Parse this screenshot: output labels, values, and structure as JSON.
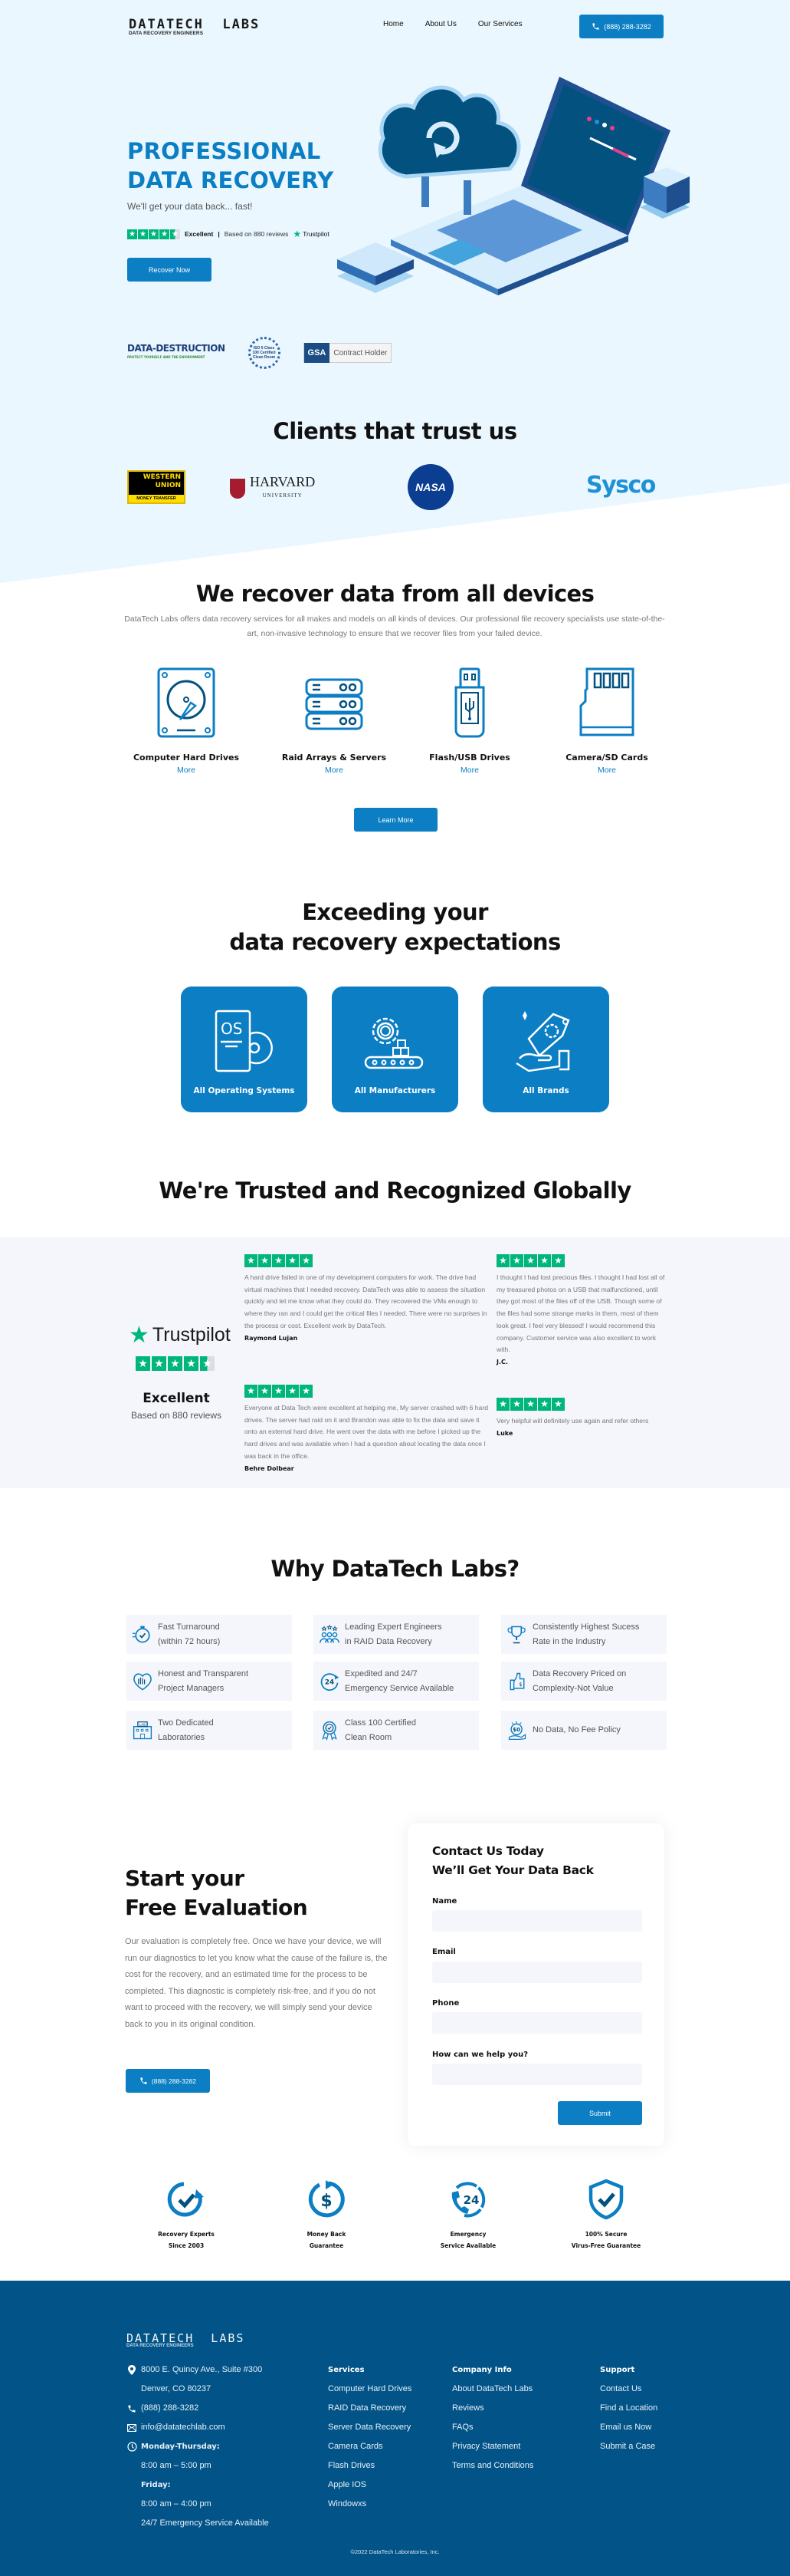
{
  "header": {
    "logo_main": "DATATECH  LABS",
    "logo_sub": "DATA RECOVERY ENGINEERS",
    "nav": [
      "Home",
      "About Us",
      "Our Services"
    ],
    "phone": "(888) 288-3282"
  },
  "hero": {
    "title_line1": "PROFESSIONAL",
    "title_line2": "DATA RECOVERY",
    "subtitle": "We'll get your data back... fast!",
    "rating_label": "Excellent",
    "rating_separator": "|",
    "rating_reviews": "Based on 880 reviews",
    "trustpilot": "Trustpilot",
    "rating_stars": 4.5,
    "cta": "Recover Now",
    "certs": {
      "data_destruction": "DATA-DESTRUCTION",
      "data_destruction_tag": "PROTECT YOURSELF AND THE ENVIRONMENT",
      "iso": "ISO 5 Class 100 Certified Clean Room",
      "gsa": "GSA",
      "gsa_text": "Contract Holder"
    }
  },
  "clients": {
    "title": "Clients that trust us",
    "logos": {
      "western_union_1": "WESTERN",
      "western_union_2": "UNION",
      "western_union_3": "MONEY TRANSFER",
      "harvard": "HARVARD",
      "harvard_sub": "UNIVERSITY",
      "nasa": "NASA",
      "sysco": "Sysco"
    }
  },
  "devices": {
    "title": "We recover data from all devices",
    "description": "DataTech Labs offers data recovery services for all makes and models on all kinds of devices. Our professional file recovery specialists use state-of-the-art, non-invasive technology to ensure that we recover files from your failed device.",
    "items": [
      {
        "name": "Computer Hard Drives",
        "link": "More",
        "icon": "hard-drive-icon"
      },
      {
        "name": "Raid Arrays & Servers",
        "link": "More",
        "icon": "server-icon"
      },
      {
        "name": "Flash/USB Drives",
        "link": "More",
        "icon": "usb-drive-icon"
      },
      {
        "name": "Camera/SD Cards",
        "link": "More",
        "icon": "sd-card-icon"
      }
    ],
    "cta": "Learn More"
  },
  "expectations": {
    "title_line1": "Exceeding your",
    "title_line2": "data recovery expectations",
    "cards": [
      {
        "label": "All Operating Systems",
        "icon": "os-disc-icon",
        "icon_text": "OS"
      },
      {
        "label": "All Manufacturers",
        "icon": "gear-conveyor-icon"
      },
      {
        "label": "All Brands",
        "icon": "brand-tag-hand-icon"
      }
    ]
  },
  "trusted": {
    "title": "We're Trusted and Recognized Globally",
    "trustpilot": "Trustpilot",
    "rating_stars": 4.5,
    "rating_label": "Excellent",
    "rating_reviews": "Based on 880 reviews",
    "reviews": [
      {
        "stars": 5,
        "text": "A hard drive failed in one of my development computers for work. The drive had virtual machines that I needed recovery. DataTech was able to assess the situation quickly and let me know what they could do. They recovered the VMs enough to where they ran and I could get the critical files I needed. There were no surprises in the process or cost. Excellent work by DataTech.",
        "author": "Raymond Lujan"
      },
      {
        "stars": 5,
        "text": "I thought I had lost precious files. I thought I had lost all of my treasured photos on a USB that malfunctioned, until they got most of the files off of the USB. Though some of the files had some strange marks in them, most of them look great. I feel very blessed! I would recommend this company. Customer service was also excellent to work with.",
        "author": "J.C."
      },
      {
        "stars": 5,
        "text": "Everyone at Data Tech were excellent at helping me, My server crashed with 6 hard drives. The server had raid on it and Brandon was able to fix the data and save it onto an external hard drive. He went over the data with me before I picked up the hard drives and was available when I had a question about locating the data once I was back in the office.",
        "author": "Behre Dolbear"
      },
      {
        "stars": 5,
        "text": "Very helpful will definitely use again and refer others",
        "author": "Luke"
      }
    ]
  },
  "why": {
    "title": "Why DataTech Labs?",
    "items": [
      {
        "line1": "Fast Turnaround",
        "line2": "(within 72 hours)",
        "icon": "stopwatch-icon"
      },
      {
        "line1": "Leading Expert Engineers",
        "line2": "in RAID Data Recovery",
        "icon": "expert-team-icon"
      },
      {
        "line1": "Consistently Highest Sucess",
        "line2": "Rate in the Industry",
        "icon": "trophy-icon"
      },
      {
        "line1": "Honest and Transparent",
        "line2": "Project Managers",
        "icon": "heart-hand-icon"
      },
      {
        "line1": "Expedited and 24/7",
        "line2": "Emergency Service Available",
        "icon": "clock-24-icon"
      },
      {
        "line1": "Data Recovery Priced on",
        "line2": "Complexity-Not Value",
        "icon": "price-tag-icon"
      },
      {
        "line1": "Two Dedicated",
        "line2": "Laboratories",
        "icon": "lab-building-icon"
      },
      {
        "line1": "Class 100 Certified",
        "line2": "Clean Room",
        "icon": "certified-badge-icon"
      },
      {
        "line1": "No Data, No Fee Policy",
        "line2": "",
        "icon": "zero-fee-icon"
      }
    ]
  },
  "evaluation": {
    "title_line1": "Start your",
    "title_line2": "Free Evaluation",
    "text": "Our evaluation is completely free. Once we have your device, we will run our diagnostics to let you know what the cause of the failure is, the cost for the recovery, and an estimated time for the process to be completed. This diagnostic is completely risk-free, and if you do not want to proceed with the recovery, we will simply send your device back to you in its original condition.",
    "phone": "(888) 288-3282"
  },
  "form": {
    "title_line1": "Contact Us Today",
    "title_line2": "We’ll Get Your Data Back",
    "fields": [
      {
        "label": "Name",
        "value": ""
      },
      {
        "label": "Email",
        "value": ""
      },
      {
        "label": "Phone",
        "value": ""
      },
      {
        "label": "How can we help you?",
        "value": ""
      }
    ],
    "submit": "Submit"
  },
  "guarantees": [
    {
      "label": "Recovery Experts\nSince 2003",
      "icon": "recovery-check-icon"
    },
    {
      "label": "Money Back\nGuarantee",
      "icon": "money-back-icon"
    },
    {
      "label": "Emergency\nService  Available",
      "icon": "phone-24-icon"
    },
    {
      "label": "100% Secure\nVirus-Free Guarantee",
      "icon": "shield-check-icon"
    }
  ],
  "footer": {
    "logo_main": "DATATECH  LABS",
    "logo_sub": "DATA RECOVERY ENGINEERS",
    "address_line1": "8000 E. Quincy Ave., Suite #300",
    "address_line2": "Denver, CO 80237",
    "phone": "(888) 288-3282",
    "email": "info@datatechlab.com",
    "hours_label1": "Monday-Thursday:",
    "hours1": "8:00 am – 5:00 pm",
    "hours_label2": "Friday:",
    "hours2": "8:00 am – 4:00 pm",
    "emergency": "24/7 Emergency Service Available",
    "columns": [
      {
        "heading": "Services",
        "links": [
          "Computer Hard Drives",
          "RAID Data Recovery",
          "Server Data Recovery",
          "Camera Cards",
          "Flash Drives",
          "Apple IOS",
          "Windowxs"
        ]
      },
      {
        "heading": "Company Info",
        "links": [
          "About DataTech Labs",
          "Reviews",
          "FAQs",
          "Privacy Statement",
          "Terms and Conditions"
        ]
      },
      {
        "heading": "Support",
        "links": [
          "Contact Us",
          "Find a Location",
          "Email us Now",
          "Submit a Case"
        ]
      }
    ],
    "copyright": "©2022 DataTech Laboratories, Inc."
  },
  "colors": {
    "brand_blue": "#0b7ec4",
    "footer_blue": "#025488",
    "hero_bg": "#eaf7fe",
    "trustpilot_green": "#00b67a",
    "panel_bg": "#f4f6fb"
  }
}
